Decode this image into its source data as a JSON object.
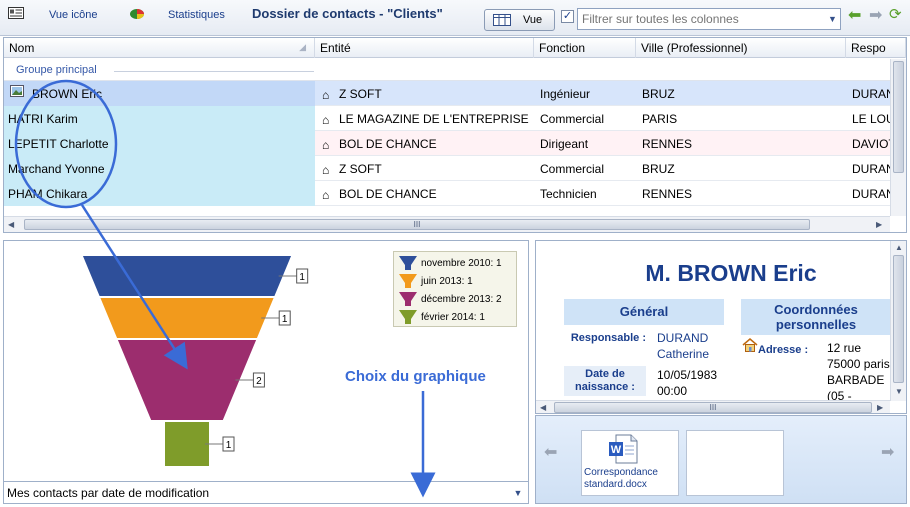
{
  "toolbar": {
    "icon_view_label": "Vue icône",
    "stats_label": "Statistiques",
    "title": "Dossier de contacts - \"Clients\"",
    "vue_button_label": "Vue",
    "filter_checked": "✓",
    "filter_placeholder": "Filtrer sur toutes les colonnes"
  },
  "grid": {
    "columns": [
      "Nom",
      "Entité",
      "Fonction",
      "Ville (Professionnel)",
      "Respo"
    ],
    "group_label": "Groupe principal",
    "rows": [
      {
        "name": "BROWN Eric",
        "entity": "Z SOFT",
        "function": "Ingénieur",
        "city": "BRUZ",
        "resp": "DURAN"
      },
      {
        "name": "HATRI Karim",
        "entity": "LE MAGAZINE DE L'ENTREPRISE",
        "function": "Commercial",
        "city": "PARIS",
        "resp": "LE LOU"
      },
      {
        "name": "LEPETIT Charlotte",
        "entity": "BOL DE CHANCE",
        "function": "Dirigeant",
        "city": "RENNES",
        "resp": "DAVIOT"
      },
      {
        "name": "Marchand Yvonne",
        "entity": "Z SOFT",
        "function": "Commercial",
        "city": "BRUZ",
        "resp": "DURAN"
      },
      {
        "name": "PHAM Chikara",
        "entity": "BOL DE CHANCE",
        "function": "Technicien",
        "city": "RENNES",
        "resp": "DURAN"
      }
    ],
    "scroll_grip": "III"
  },
  "chart_data": {
    "type": "funnel",
    "categories": [
      "novembre 2010",
      "juin 2013",
      "décembre 2013",
      "février 2014"
    ],
    "values": [
      1,
      1,
      2,
      1
    ],
    "legend": [
      "novembre 2010: 1",
      "juin 2013: 1",
      "décembre 2013: 2",
      "février 2014: 1"
    ],
    "colors": [
      "#2e4f9a",
      "#f29a1c",
      "#9c2d6e",
      "#7f9c2a"
    ],
    "legend_position": "top-right"
  },
  "chart_select": {
    "value": "Mes contacts par date de modification"
  },
  "annotation": {
    "label": "Choix du graphique"
  },
  "detail": {
    "name": "M. BROWN Eric",
    "general_header": "Général",
    "coords_header_line1": "Coordonnées",
    "coords_header_line2": "personnelles",
    "responsable_label": "Responsable :",
    "responsable_value1": "DURAND",
    "responsable_value2": "Catherine",
    "birth_label1": "Date de",
    "birth_label2": "naissance :",
    "birth_value1": "10/05/1983",
    "birth_value2": "00:00",
    "address_label": "Adresse :",
    "address_line1": "12 rue",
    "address_line2": "75000 paris",
    "address_line3": "BARBADE",
    "address_line4": "(05 -",
    "scroll_grip": "III"
  },
  "documents": {
    "items": [
      {
        "label": "Correspondance standard.docx"
      }
    ]
  }
}
